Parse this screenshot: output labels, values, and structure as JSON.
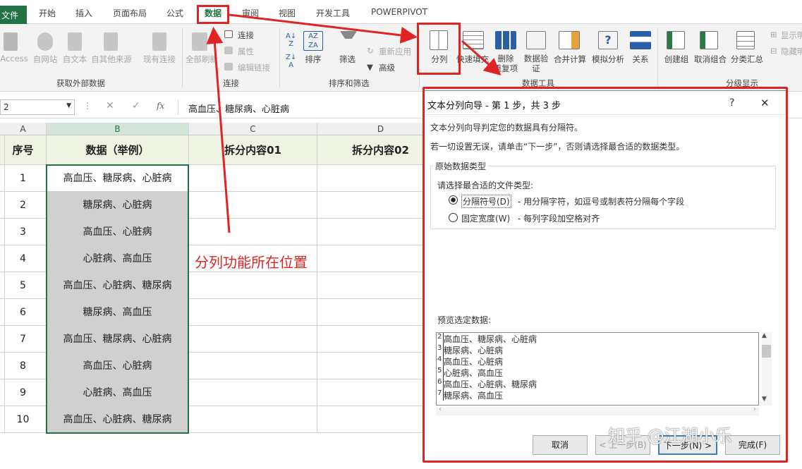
{
  "tabs": [
    "文件",
    "开始",
    "插入",
    "页面布局",
    "公式",
    "数据",
    "审阅",
    "视图",
    "开发工具",
    "POWERPIVOT"
  ],
  "ribbon": {
    "external": [
      "Access",
      "自网站",
      "自文本",
      "自其他来源",
      "现有连接"
    ],
    "refresh": "全部刷新",
    "connections": [
      "连接",
      "属性",
      "编辑链接"
    ],
    "sort": "排序",
    "filter": "筛选",
    "reapply": "重新应用",
    "advanced": "高级",
    "tools": [
      "分列",
      "快速填充",
      "删除\n重复项",
      "数据验\n证",
      "合并计算",
      "模拟分析",
      "关系"
    ],
    "outline": [
      "创建组",
      "取消组合",
      "分类汇总"
    ],
    "show_detail": "显示明细",
    "hide_detail": "隐藏明细",
    "groups": [
      "获取外部数据",
      "连接",
      "排序和筛选",
      "数据工具",
      "分级显示"
    ]
  },
  "formula": {
    "namebox": "2",
    "fx": "fx",
    "content": "高血压、糖尿病、心脏病"
  },
  "sheet": {
    "columns": [
      "A",
      "B",
      "C",
      "D"
    ],
    "headers": [
      "序号",
      "数据（举例）",
      "拆分内容01",
      "拆分内容02"
    ],
    "rows": [
      [
        "1",
        "高血压、糖尿病、心脏病"
      ],
      [
        "2",
        "糖尿病、心脏病"
      ],
      [
        "3",
        "高血压、心脏病"
      ],
      [
        "4",
        "心脏病、高血压"
      ],
      [
        "5",
        "高血压、心脏病、糖尿病"
      ],
      [
        "6",
        "糖尿病、高血压"
      ],
      [
        "7",
        "高血压、糖尿病、心脏病"
      ],
      [
        "8",
        "高血压、心脏病"
      ],
      [
        "9",
        "心脏病、高血压"
      ],
      [
        "10",
        "高血压、心脏病、糖尿病"
      ]
    ]
  },
  "annotation": "分列功能所在位置",
  "dialog": {
    "title": "文本分列向导 - 第 1 步，共 3 步",
    "help": "?",
    "close": "✕",
    "line1": "文本分列向导判定您的数据具有分隔符。",
    "line2": "若一切设置无误，请单击“下一步”，否则请选择最合适的数据类型。",
    "group_title": "原始数据类型",
    "choose": "请选择最合适的文件类型:",
    "opt1": "分隔符号(D)",
    "opt1_desc": "- 用分隔字符，如逗号或制表符分隔每个字段",
    "opt2": "固定宽度(W)",
    "opt2_desc": "- 每列字段加空格对齐",
    "preview_title": "预览选定数据:",
    "preview_nums": [
      "2",
      "3",
      "4",
      "5",
      "6",
      "7"
    ],
    "preview_rows": [
      "高血压、糖尿病、心脏病",
      "糖尿病、心脏病",
      "高血压、心脏病",
      "心脏病、高血压",
      "高血压、心脏病、糖尿病",
      "糖尿病、高血压"
    ],
    "cancel": "取消",
    "back": "< 上一步(B)",
    "next": "下一步(N) >",
    "finish": "完成(F)"
  },
  "watermark": "知乎 @江湖小乐",
  "colors": {
    "accent": "#217346",
    "red": "#e02424",
    "selected_cell": "#d0d0d0",
    "header_fill": "#eef3e4"
  }
}
